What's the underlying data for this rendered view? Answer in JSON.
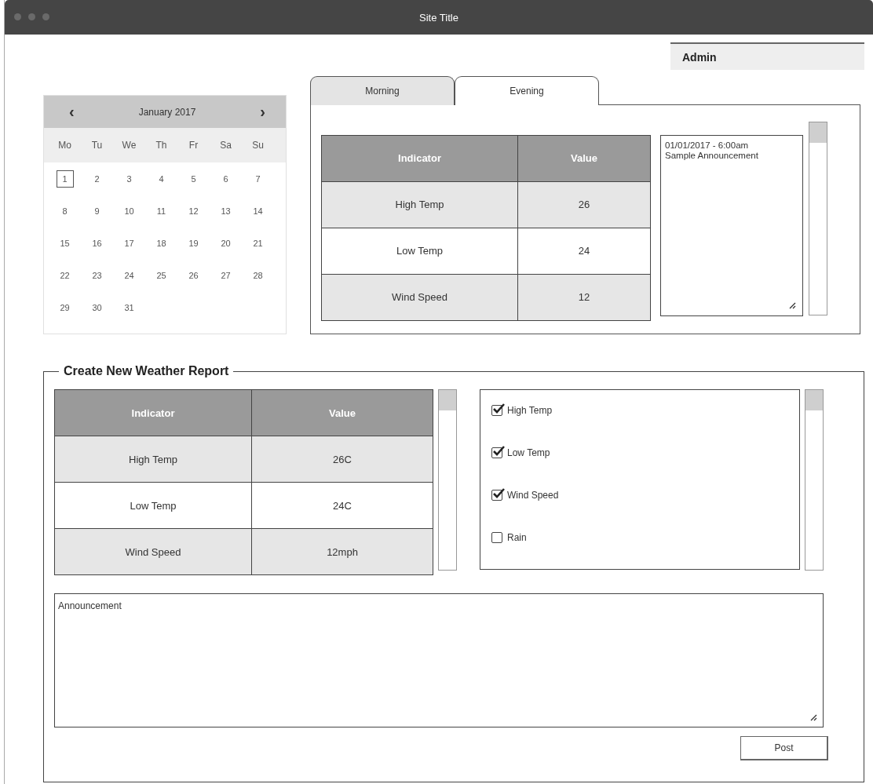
{
  "window": {
    "title": "Site Title"
  },
  "user": {
    "name": "Admin"
  },
  "calendar": {
    "month": "January 2017",
    "prev": "‹",
    "next": "›",
    "weekdays": [
      "Mo",
      "Tu",
      "We",
      "Th",
      "Fr",
      "Sa",
      "Su"
    ],
    "weeks": [
      [
        {
          "label": "1",
          "selected": true
        },
        {
          "label": "2",
          "selected": false
        },
        {
          "label": "3",
          "selected": false
        },
        {
          "label": "4",
          "selected": false
        },
        {
          "label": "5",
          "selected": false
        },
        {
          "label": "6",
          "selected": false
        },
        {
          "label": "7",
          "selected": false
        }
      ],
      [
        {
          "label": "8",
          "selected": false
        },
        {
          "label": "9",
          "selected": false
        },
        {
          "label": "10",
          "selected": false
        },
        {
          "label": "11",
          "selected": false
        },
        {
          "label": "12",
          "selected": false
        },
        {
          "label": "13",
          "selected": false
        },
        {
          "label": "14",
          "selected": false
        }
      ],
      [
        {
          "label": "15",
          "selected": false
        },
        {
          "label": "16",
          "selected": false
        },
        {
          "label": "17",
          "selected": false
        },
        {
          "label": "18",
          "selected": false
        },
        {
          "label": "19",
          "selected": false
        },
        {
          "label": "20",
          "selected": false
        },
        {
          "label": "21",
          "selected": false
        }
      ],
      [
        {
          "label": "22",
          "selected": false
        },
        {
          "label": "23",
          "selected": false
        },
        {
          "label": "24",
          "selected": false
        },
        {
          "label": "25",
          "selected": false
        },
        {
          "label": "26",
          "selected": false
        },
        {
          "label": "27",
          "selected": false
        },
        {
          "label": "28",
          "selected": false
        }
      ],
      [
        {
          "label": "29",
          "selected": false
        },
        {
          "label": "30",
          "selected": false
        },
        {
          "label": "31",
          "selected": false
        }
      ]
    ]
  },
  "tabs": [
    {
      "label": "Morning",
      "selected": false
    },
    {
      "label": "Evening",
      "selected": true
    }
  ],
  "report_table": {
    "columns": [
      "Indicator",
      "Value"
    ],
    "rows": [
      [
        "High Temp",
        "26"
      ],
      [
        "Low Temp",
        "24"
      ],
      [
        "Wind Speed",
        "12"
      ]
    ]
  },
  "announcement": {
    "lines": [
      "01/01/2017 - 6:00am",
      "Sample Announcement"
    ]
  },
  "new_report": {
    "title": "Create New Weather Report",
    "table": {
      "columns": [
        "Indicator",
        "Value"
      ],
      "rows": [
        [
          "High Temp",
          "26C"
        ],
        [
          "Low Temp",
          "24C"
        ],
        [
          "Wind Speed",
          "12mph"
        ]
      ]
    },
    "options": [
      {
        "label": "High Temp",
        "checked": true
      },
      {
        "label": "Low Temp",
        "checked": true
      },
      {
        "label": "Wind Speed",
        "checked": true
      },
      {
        "label": "Rain",
        "checked": false
      }
    ],
    "announcement": {
      "placeholder": "Announcement"
    },
    "post_button": "Post"
  }
}
